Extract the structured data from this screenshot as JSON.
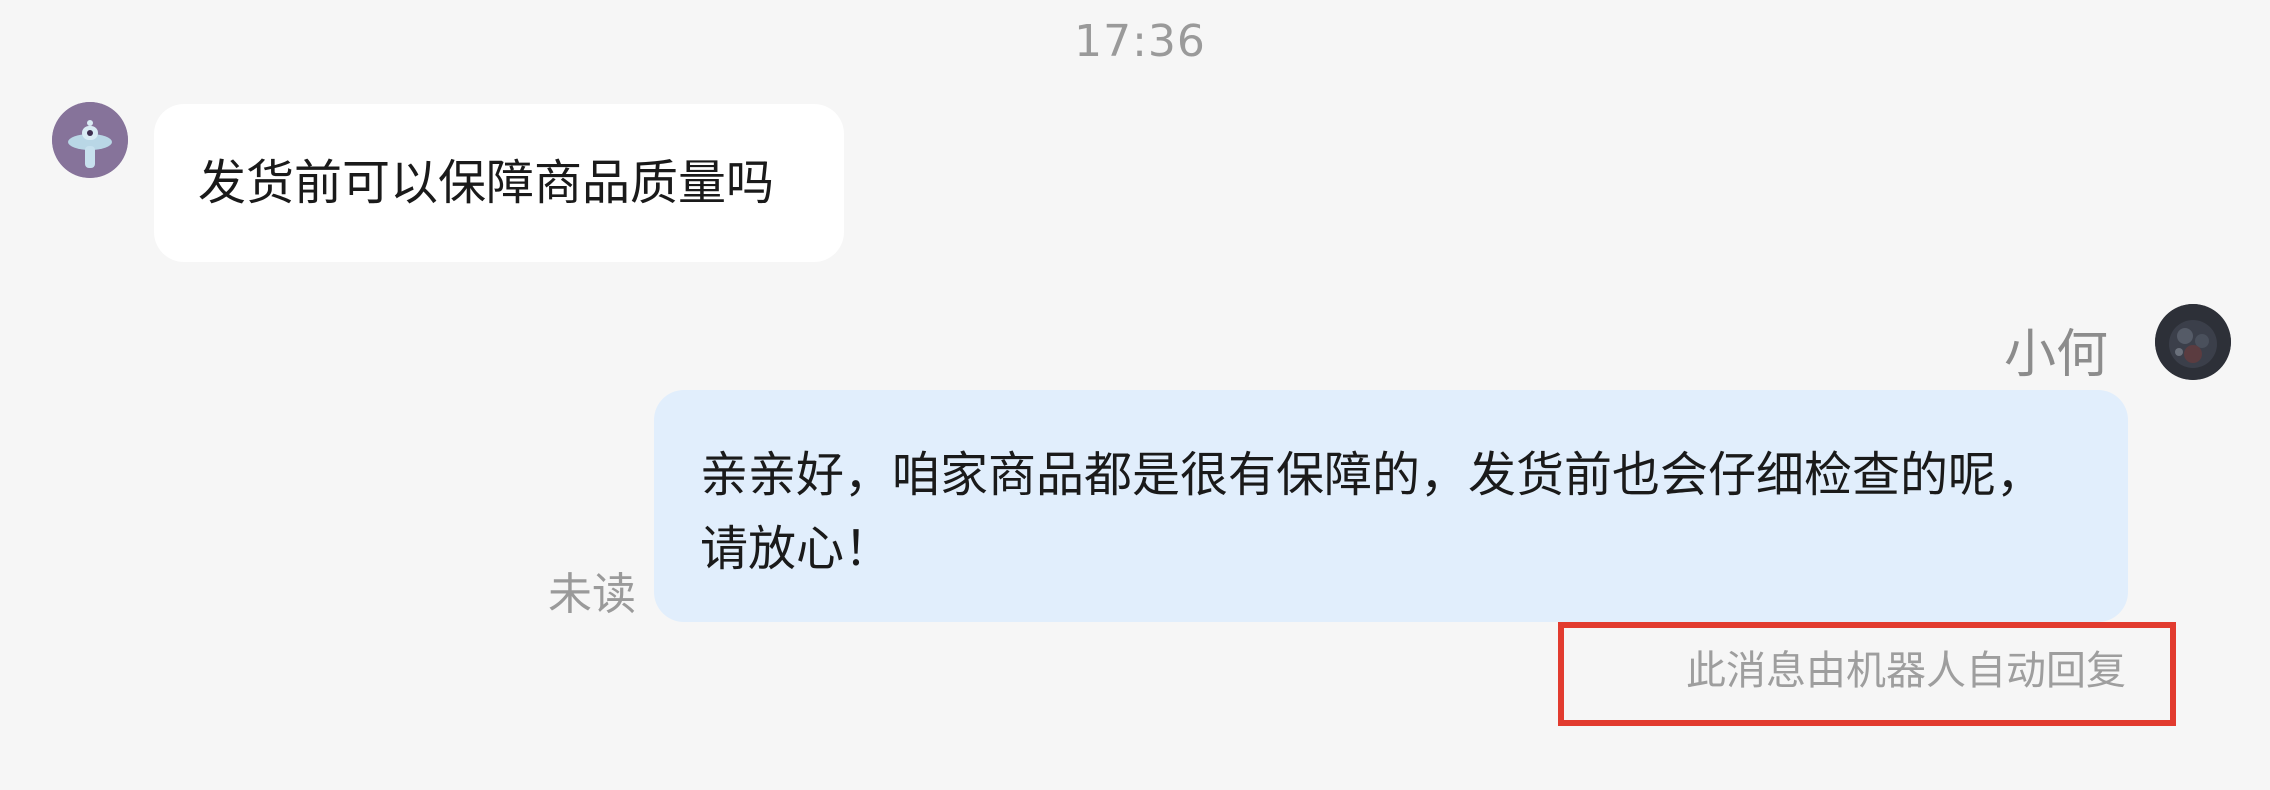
{
  "chat": {
    "timestamp": "17:36",
    "customer_message": {
      "avatar": "robot-avatar-icon",
      "text": "发货前可以保障商品质量吗"
    },
    "agent_message": {
      "sender_name": "小何",
      "avatar": "agent-avatar-icon",
      "text": "亲亲好，咱家商品都是很有保障的，发货前也会仔细检查的呢，请放心！",
      "read_status": "未读",
      "auto_reply_note": "此消息由机器人自动回复"
    }
  },
  "colors": {
    "background": "#f6f6f6",
    "customer_bubble": "#ffffff",
    "agent_bubble": "#e1eefc",
    "highlight_box": "#e23b2f",
    "muted_text": "#9a9a9a"
  }
}
